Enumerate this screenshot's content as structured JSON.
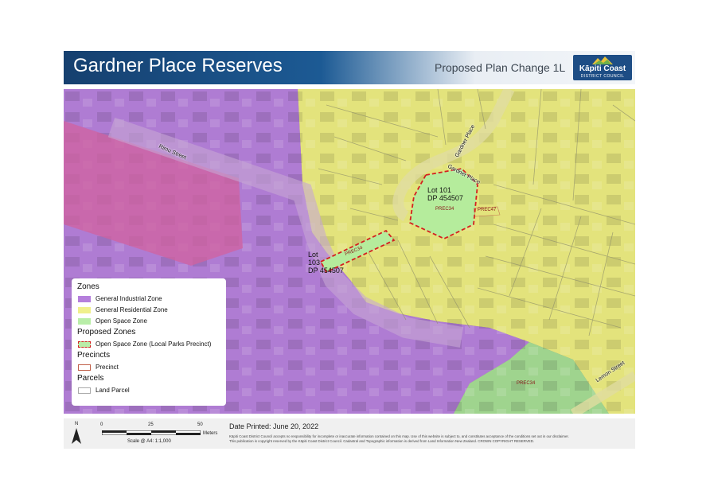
{
  "header": {
    "title": "Gardner Place Reserves",
    "subtitle": "Proposed Plan Change 1L",
    "logo_name": "Kāpiti Coast",
    "logo_sub": "DISTRICT COUNCIL"
  },
  "map": {
    "streets": {
      "rimu": "Rimu Street",
      "gardner_place_1": "Gardner Place",
      "gardner_place_2": "Gardner Place",
      "lemon": "Lemon Street"
    },
    "lots": {
      "lot101_line1": "Lot 101",
      "lot101_line2": "DP 454507",
      "lot103_line1": "Lot",
      "lot103_line2": "103",
      "lot103_line3": "DP 454507"
    },
    "precincts": {
      "p1": "PREC34",
      "p2": "PREC34",
      "p3": "PREC47",
      "p4": "PREC34"
    }
  },
  "legend": {
    "zones_heading": "Zones",
    "industrial": "General Industrial Zone",
    "residential": "General Residential Zone",
    "open_space": "Open Space Zone",
    "proposed_heading": "Proposed Zones",
    "proposed_item": "Open Space Zone (Local Parks Precinct)",
    "precincts_heading": "Precincts",
    "precinct_item": "Precinct",
    "parcels_heading": "Parcels",
    "parcel_item": "Land Parcel"
  },
  "colors": {
    "industrial": "#b57fdc",
    "residential": "#f0f08c",
    "open_space": "#b9eea8",
    "proposed_border": "#d42020",
    "precinct_border": "#c0604a",
    "parcel_border": "#aaaaaa"
  },
  "footer": {
    "north": "N",
    "scale_0": "0",
    "scale_25": "25",
    "scale_50": "50",
    "scale_unit": "Meters",
    "scale_ratio": "Scale @ A4: 1:1,000",
    "date_printed": "Date Printed: June 20, 2022",
    "disclaimer_1": "Kāpiti Coast District Council accepts no responsibility for incomplete or inaccurate information contained on this map. Use of this website is subject to, and constitutes acceptance of the conditions set out in our disclaimer.",
    "disclaimer_2": "This publication is copyright reserved by the Kāpiti Coast District Council. Cadastral and Topographic information is derived from Land Information New Zealand. CROWN COPYRIGHT RESERVED."
  }
}
